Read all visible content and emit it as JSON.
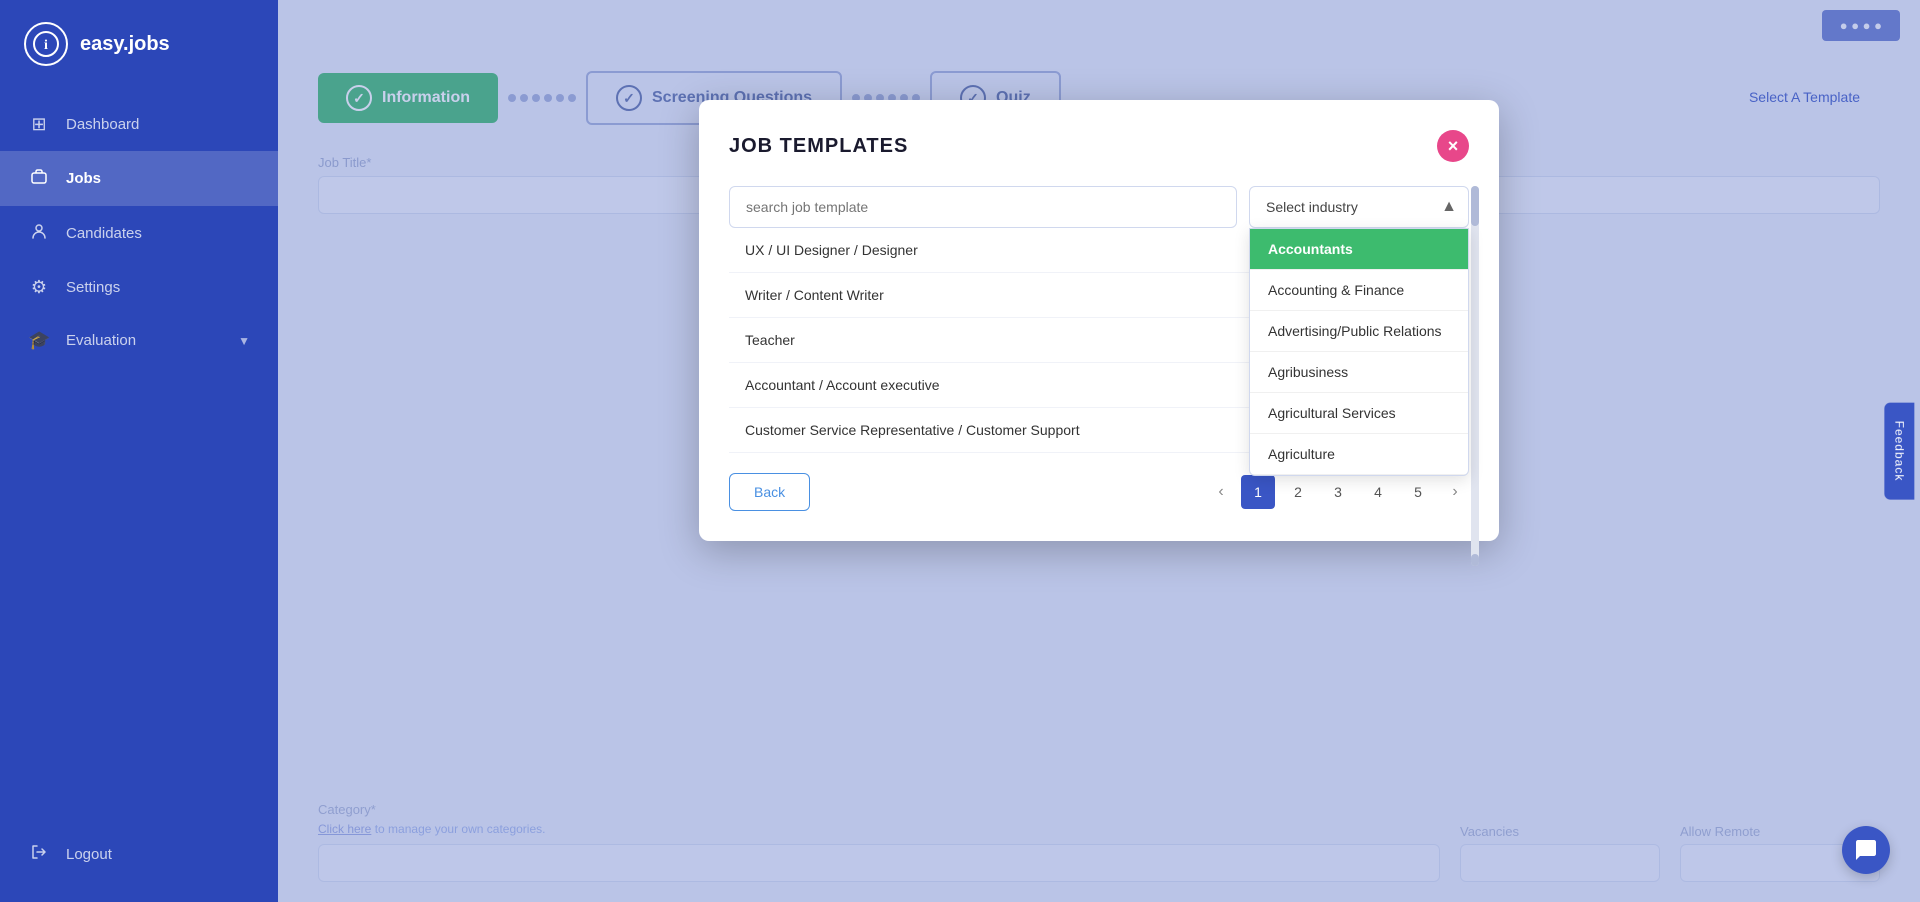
{
  "app": {
    "logo_text": "easy.jobs",
    "logo_icon": "i"
  },
  "sidebar": {
    "items": [
      {
        "id": "dashboard",
        "label": "Dashboard",
        "icon": "⊞"
      },
      {
        "id": "jobs",
        "label": "Jobs",
        "icon": "💼",
        "active": true
      },
      {
        "id": "candidates",
        "label": "Candidates",
        "icon": "👤"
      },
      {
        "id": "settings",
        "label": "Settings",
        "icon": "⚙"
      },
      {
        "id": "evaluation",
        "label": "Evaluation",
        "icon": "🎓"
      }
    ],
    "logout_label": "Logout",
    "logout_icon": "⏻"
  },
  "wizard": {
    "steps": [
      {
        "id": "information",
        "label": "Information",
        "icon": "✓",
        "active": true
      },
      {
        "id": "screening",
        "label": "Screening Questions",
        "icon": "✓",
        "active": false
      },
      {
        "id": "quiz",
        "label": "Quiz",
        "icon": "✓",
        "active": false
      }
    ]
  },
  "page": {
    "select_template_link": "Select A Template"
  },
  "modal": {
    "title": "JOB TEMPLATES",
    "close_btn": "×",
    "search_placeholder": "search job template",
    "industry_placeholder": "Select industry",
    "job_templates": [
      {
        "id": 1,
        "label": "UX / UI Designer / Designer"
      },
      {
        "id": 2,
        "label": "Writer / Content Writer"
      },
      {
        "id": 3,
        "label": "Teacher"
      },
      {
        "id": 4,
        "label": "Accountant / Account executive"
      },
      {
        "id": 5,
        "label": "Customer Service Representative / Customer Support"
      }
    ],
    "industries": [
      {
        "id": "accountants",
        "label": "Accountants",
        "selected": true
      },
      {
        "id": "accounting-finance",
        "label": "Accounting & Finance"
      },
      {
        "id": "advertising",
        "label": "Advertising/Public Relations"
      },
      {
        "id": "agribusiness",
        "label": "Agribusiness"
      },
      {
        "id": "agricultural-services",
        "label": "Agricultural Services"
      },
      {
        "id": "agriculture",
        "label": "Agriculture"
      }
    ],
    "pagination": {
      "back_label": "Back",
      "current_page": 1,
      "pages": [
        1,
        2,
        3,
        4,
        5
      ]
    }
  },
  "feedback_label": "Feedback",
  "background": {
    "category_label": "Category*",
    "category_link_text": "Click here",
    "category_link_suffix": "to manage your own categories.",
    "vacancies_label": "Vacancies",
    "allow_remote_label": "Allow Remote"
  }
}
